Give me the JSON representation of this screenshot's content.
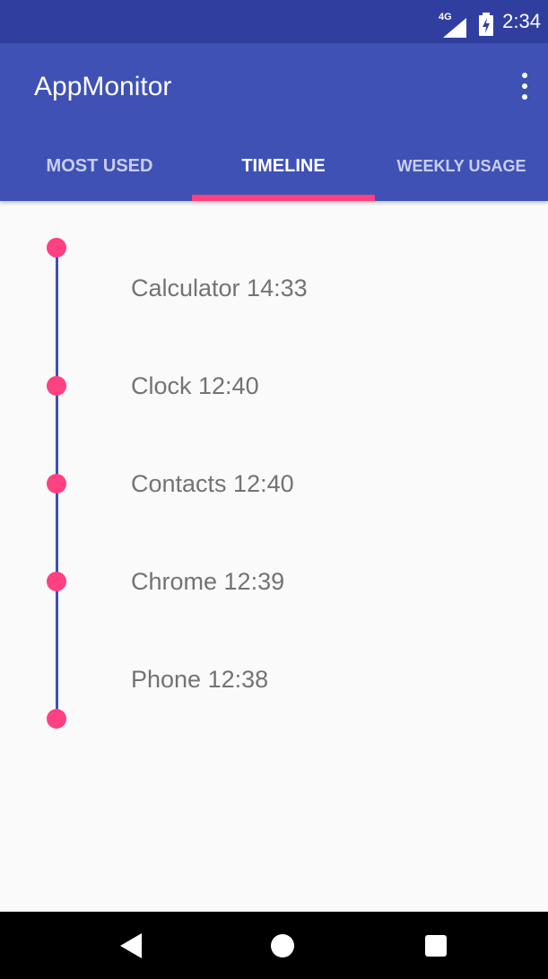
{
  "status_bar": {
    "network": "4G",
    "time": "2:34",
    "icons": [
      "signal-icon",
      "battery-charging-icon"
    ]
  },
  "app_bar": {
    "title": "AppMonitor",
    "menu_icon": "overflow-menu-icon"
  },
  "tabs": [
    {
      "label": "MOST USED",
      "selected": false
    },
    {
      "label": "TIMELINE",
      "selected": true
    },
    {
      "label": "WEEKLY USAGE",
      "selected": false
    }
  ],
  "colors": {
    "primary": "#3f51b5",
    "primary_dark": "#303f9f",
    "accent": "#ff4081",
    "entry_text": "#737373"
  },
  "timeline": {
    "entries": [
      {
        "label": "Calculator 14:33"
      },
      {
        "label": "Clock 12:40"
      },
      {
        "label": "Contacts 12:40"
      },
      {
        "label": "Chrome 12:39"
      },
      {
        "label": "Phone 12:38"
      }
    ]
  },
  "nav_bar": {
    "icons": [
      "back-icon",
      "home-icon",
      "recents-icon"
    ]
  }
}
